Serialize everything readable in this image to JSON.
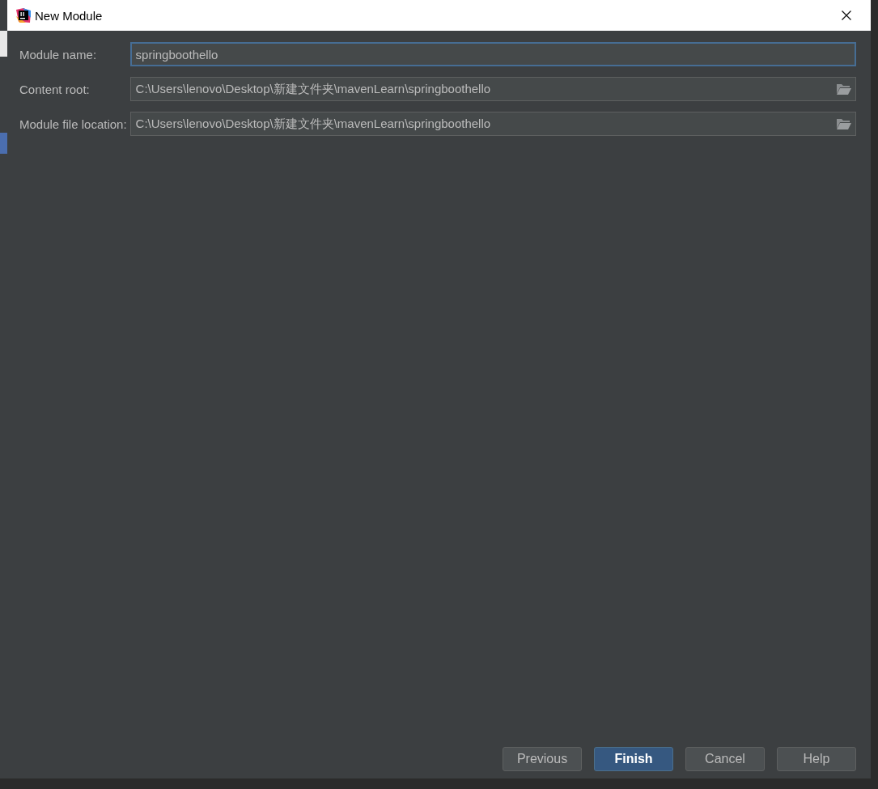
{
  "window": {
    "title": "New Module"
  },
  "fields": [
    {
      "kind": "text",
      "label": "Module name:",
      "value": "springboothello",
      "focused": true
    },
    {
      "kind": "path",
      "label": "Content root:",
      "value": "C:\\Users\\lenovo\\Desktop\\新建文件夹\\mavenLearn\\springboothello",
      "focused": false
    },
    {
      "kind": "path",
      "label": "Module file location:",
      "value": "C:\\Users\\lenovo\\Desktop\\新建文件夹\\mavenLearn\\springboothello",
      "focused": false
    }
  ],
  "buttons": [
    {
      "label": "Previous",
      "default": false
    },
    {
      "label": "Finish",
      "default": true
    },
    {
      "label": "Cancel",
      "default": false
    },
    {
      "label": "Help",
      "default": false
    }
  ]
}
